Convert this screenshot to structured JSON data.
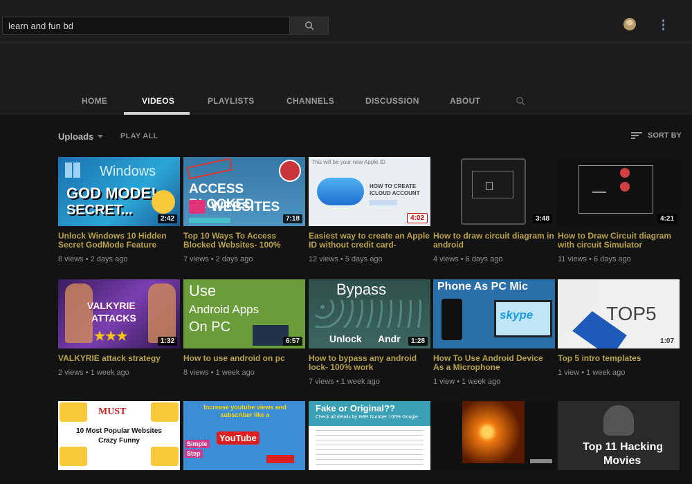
{
  "search": {
    "value": "learn and fun bd",
    "placeholder": "Search"
  },
  "tabs": [
    {
      "label": "HOME",
      "active": false
    },
    {
      "label": "VIDEOS",
      "active": true
    },
    {
      "label": "PLAYLISTS",
      "active": false
    },
    {
      "label": "CHANNELS",
      "active": false
    },
    {
      "label": "DISCUSSION",
      "active": false
    },
    {
      "label": "ABOUT",
      "active": false
    }
  ],
  "section": {
    "title": "Uploads",
    "play_all": "PLAY ALL",
    "sort_by": "SORT BY"
  },
  "videos": [
    {
      "title": "Unlock Windows 10 Hidden Secret GodMode Feature",
      "meta": "8 views • 2 days ago",
      "duration": "2:42",
      "thumb_text": [
        "Windows",
        "GOD MODE!",
        "SECRET..."
      ]
    },
    {
      "title": "Top 10 Ways To Access Blocked Websites- 100%",
      "meta": "7 views • 2 days ago",
      "duration": "7:18",
      "thumb_text": [
        "ACCESS BLOCKED",
        "WEBSITES"
      ]
    },
    {
      "title": "Easiest way to create an Apple ID without credit card-",
      "meta": "12 views • 5 days ago",
      "duration": "4:02",
      "thumb_text": [
        "This will be your new Apple ID",
        "HOW TO CREATE ICLOUD ACCOUNT"
      ]
    },
    {
      "title": "How to draw circuit diagram in android",
      "meta": "4 views • 6 days ago",
      "duration": "3:48",
      "thumb_text": []
    },
    {
      "title": "How to Draw Circuit diagram with circuit Simulator",
      "meta": "11 views • 6 days ago",
      "duration": "4:21",
      "thumb_text": []
    },
    {
      "title": "VALKYRIE attack strategy",
      "meta": "2 views • 1 week ago",
      "duration": "1:32",
      "thumb_text": [
        "VALKYRIE",
        "ATTACKS"
      ]
    },
    {
      "title": "How to use android on pc",
      "meta": "8 views • 1 week ago",
      "duration": "6:57",
      "thumb_text": [
        "Use",
        "Android Apps",
        "On PC"
      ]
    },
    {
      "title": "How to bypass any android lock- 100% work",
      "meta": "7 views • 1 week ago",
      "duration": "1:28",
      "thumb_text": [
        "Bypass",
        "Unlock",
        "Andr"
      ]
    },
    {
      "title": "How To Use Android Device As a Microphone",
      "meta": "1 view • 1 week ago",
      "duration": "",
      "thumb_text": [
        "Phone As PC Mic",
        "skype"
      ]
    },
    {
      "title": "Top 5 intro templates",
      "meta": "1 view • 1 week ago",
      "duration": "1:07",
      "thumb_text": [
        "TOP5"
      ]
    },
    {
      "title": "",
      "meta": "",
      "duration": "",
      "thumb_text": [
        "MUST",
        "10 Most Popular Websites",
        "Crazy Funny"
      ]
    },
    {
      "title": "",
      "meta": "",
      "duration": "",
      "thumb_text": [
        "Increase youtube views and subscriber like a",
        "YouTube",
        "Simple",
        "Step"
      ]
    },
    {
      "title": "",
      "meta": "",
      "duration": "",
      "thumb_text": [
        "Fake or Original??",
        "Check all details by IMEI Number 100% Google"
      ]
    },
    {
      "title": "",
      "meta": "",
      "duration": "",
      "thumb_text": []
    },
    {
      "title": "",
      "meta": "",
      "duration": "",
      "thumb_text": [
        "Top 11 Hacking",
        "Movies"
      ]
    }
  ],
  "colors": {
    "title_gold": "#b8a24a",
    "accent_underline": "#cfcfcf"
  }
}
